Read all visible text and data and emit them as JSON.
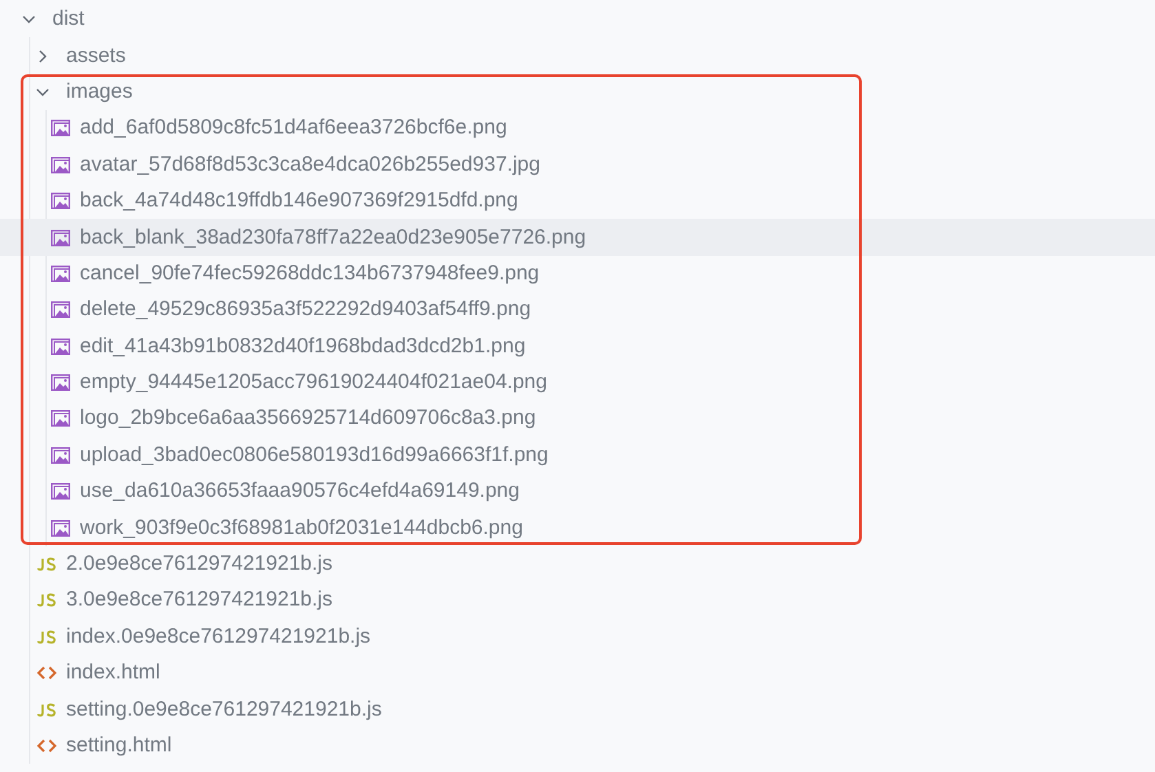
{
  "tree": [
    {
      "kind": "folder",
      "label": "dist",
      "expanded": true,
      "highlighted": false,
      "children": [
        {
          "kind": "folder",
          "label": "assets",
          "expanded": false,
          "highlighted": false
        },
        {
          "kind": "folder",
          "label": "images",
          "expanded": true,
          "highlighted": true,
          "children": [
            {
              "kind": "image",
              "label": "add_6af0d5809c8fc51d4af6eea3726bcf6e.png",
              "selected": false
            },
            {
              "kind": "image",
              "label": "avatar_57d68f8d53c3ca8e4dca026b255ed937.jpg",
              "selected": false
            },
            {
              "kind": "image",
              "label": "back_4a74d48c19ffdb146e907369f2915dfd.png",
              "selected": false
            },
            {
              "kind": "image",
              "label": "back_blank_38ad230fa78ff7a22ea0d23e905e7726.png",
              "selected": true
            },
            {
              "kind": "image",
              "label": "cancel_90fe74fec59268ddc134b6737948fee9.png",
              "selected": false
            },
            {
              "kind": "image",
              "label": "delete_49529c86935a3f522292d9403af54ff9.png",
              "selected": false
            },
            {
              "kind": "image",
              "label": "edit_41a43b91b0832d40f1968bdad3dcd2b1.png",
              "selected": false
            },
            {
              "kind": "image",
              "label": "empty_94445e1205acc79619024404f021ae04.png",
              "selected": false
            },
            {
              "kind": "image",
              "label": "logo_2b9bce6a6aa3566925714d609706c8a3.png",
              "selected": false
            },
            {
              "kind": "image",
              "label": "upload_3bad0ec0806e580193d16d99a6663f1f.png",
              "selected": false
            },
            {
              "kind": "image",
              "label": "use_da610a36653faaa90576c4efd4a69149.png",
              "selected": false
            },
            {
              "kind": "image",
              "label": "work_903f9e0c3f68981ab0f2031e144dbcb6.png",
              "selected": false
            }
          ]
        },
        {
          "kind": "js",
          "label": "2.0e9e8ce761297421921b.js",
          "selected": false
        },
        {
          "kind": "js",
          "label": "3.0e9e8ce761297421921b.js",
          "selected": false
        },
        {
          "kind": "js",
          "label": "index.0e9e8ce761297421921b.js",
          "selected": false
        },
        {
          "kind": "html",
          "label": "index.html",
          "selected": false
        },
        {
          "kind": "js",
          "label": "setting.0e9e8ce761297421921b.js",
          "selected": false
        },
        {
          "kind": "html",
          "label": "setting.html",
          "selected": false
        }
      ]
    }
  ]
}
